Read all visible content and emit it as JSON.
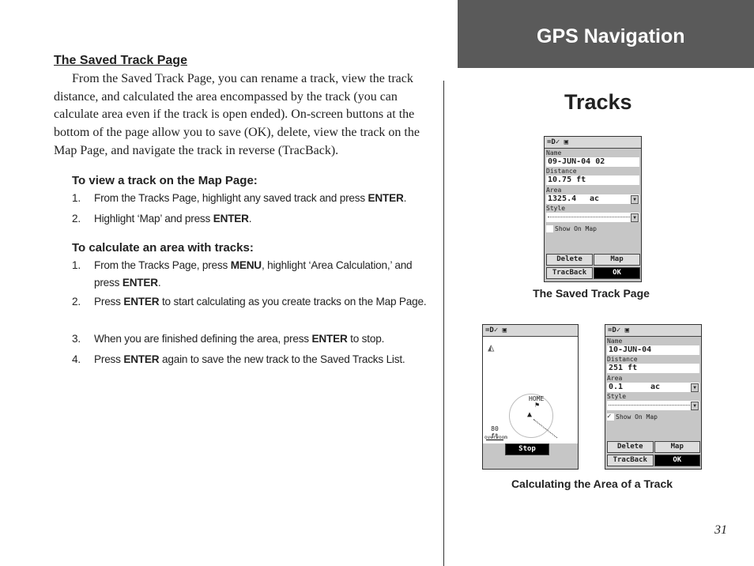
{
  "header": {
    "section": "GPS Navigation",
    "title": "Tracks"
  },
  "left": {
    "heading": "The Saved Track Page",
    "paragraph": "From the Saved Track Page, you can rename a track, view the track distance, and calculated the area encompassed by the track (you can calculate area even if the track is open ended). On-screen buttons at the bottom of the page allow you to save (OK), delete, view the track on the Map Page, and navigate the track in reverse (TracBack).",
    "view_heading": "To view a track on the Map Page:",
    "view_steps": [
      {
        "n": "1.",
        "parts": [
          "From the Tracks Page, highlight any saved track and press ",
          "ENTER",
          "."
        ]
      },
      {
        "n": "2.",
        "parts": [
          "Highlight ‘Map’ and press ",
          "ENTER",
          "."
        ]
      }
    ],
    "calc_heading": "To calculate an area with tracks:",
    "calc_steps": [
      {
        "n": "1.",
        "parts": [
          "From the Tracks Page, press ",
          "MENU",
          ", highlight ‘Area Calculation,’ and press ",
          "ENTER",
          "."
        ]
      },
      {
        "n": "2.",
        "parts": [
          "Press ",
          "ENTER",
          " to start calculating as you create tracks on the Map Page."
        ]
      },
      {
        "n": "3.",
        "parts": [
          "When you are finished defining the area, press ",
          "ENTER",
          " to stop."
        ]
      },
      {
        "n": "4.",
        "parts": [
          "Press ",
          "ENTER",
          " again to save the new track to the Saved Tracks List."
        ]
      }
    ]
  },
  "figures": {
    "caption1": "The Saved Track Page",
    "caption2": "Calculating the Area of a Track",
    "status_icons": "=D✓ ▣",
    "saved": {
      "name_label": "Name",
      "name": "09-JUN-04 02",
      "distance_label": "Distance",
      "distance": "10.75 ft",
      "area_label": "Area",
      "area": "1325.4",
      "area_unit": "ac",
      "style_label": "Style",
      "show_on_map": "Show On Map",
      "show_checked": false,
      "buttons": [
        "Delete",
        "Map",
        "TracBack",
        "OK"
      ]
    },
    "map": {
      "home": "HOME",
      "scale": "80 ft",
      "overzoom": "overzoom",
      "stop": "Stop"
    },
    "calc": {
      "name_label": "Name",
      "name": "10-JUN-04",
      "distance_label": "Distance",
      "distance": "251 ft",
      "area_label": "Area",
      "area": "0.1",
      "area_unit": "ac",
      "style_label": "Style",
      "show_on_map": "Show On Map",
      "show_checked": true,
      "buttons": [
        "Delete",
        "Map",
        "TracBack",
        "OK"
      ]
    }
  },
  "page_number": "31"
}
